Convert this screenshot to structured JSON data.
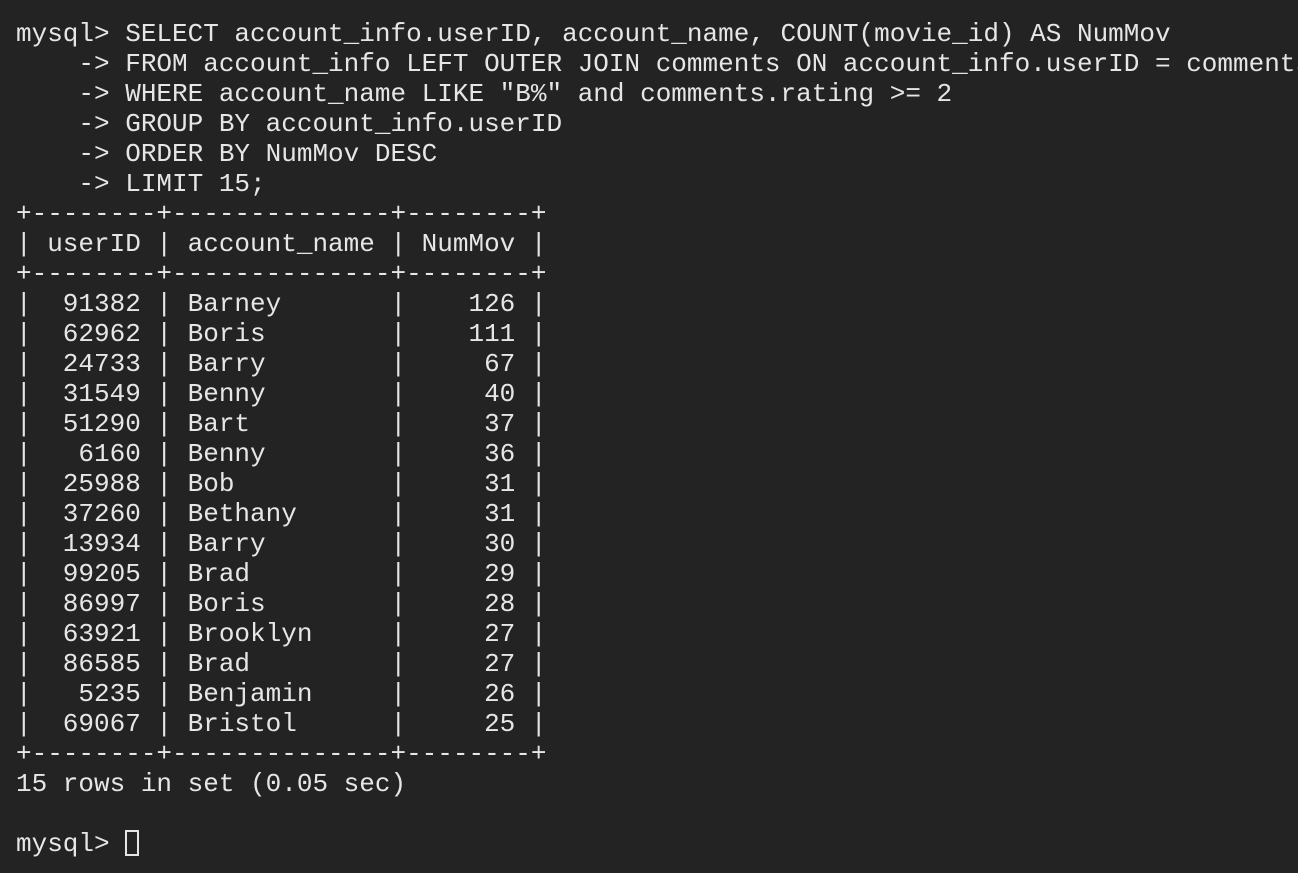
{
  "terminal": {
    "query": [
      "mysql> SELECT account_info.userID, account_name, COUNT(movie_id) AS NumMov",
      "    -> FROM account_info LEFT OUTER JOIN comments ON account_info.userID = comments.userID",
      "    -> WHERE account_name LIKE \"B%\" and comments.rating >= 2",
      "    -> GROUP BY account_info.userID",
      "    -> ORDER BY NumMov DESC",
      "    -> LIMIT 15;"
    ],
    "table": {
      "border": "+--------+--------------+--------+",
      "header": "| userID | account_name | NumMov |",
      "columns": [
        "userID",
        "account_name",
        "NumMov"
      ],
      "rows": [
        [
          "91382",
          "Barney",
          "126"
        ],
        [
          "62962",
          "Boris",
          "111"
        ],
        [
          "24733",
          "Barry",
          "67"
        ],
        [
          "31549",
          "Benny",
          "40"
        ],
        [
          "51290",
          "Bart",
          "37"
        ],
        [
          "6160",
          "Benny",
          "36"
        ],
        [
          "25988",
          "Bob",
          "31"
        ],
        [
          "37260",
          "Bethany",
          "31"
        ],
        [
          "13934",
          "Barry",
          "30"
        ],
        [
          "99205",
          "Brad",
          "29"
        ],
        [
          "86997",
          "Boris",
          "28"
        ],
        [
          "63921",
          "Brooklyn",
          "27"
        ],
        [
          "86585",
          "Brad",
          "27"
        ],
        [
          "5235",
          "Benjamin",
          "26"
        ],
        [
          "69067",
          "Bristol",
          "25"
        ]
      ]
    },
    "result_summary": "15 rows in set (0.05 sec)",
    "prompt": "mysql> ",
    "colors": {
      "background": "#232323",
      "foreground": "#e6e6e6"
    }
  }
}
